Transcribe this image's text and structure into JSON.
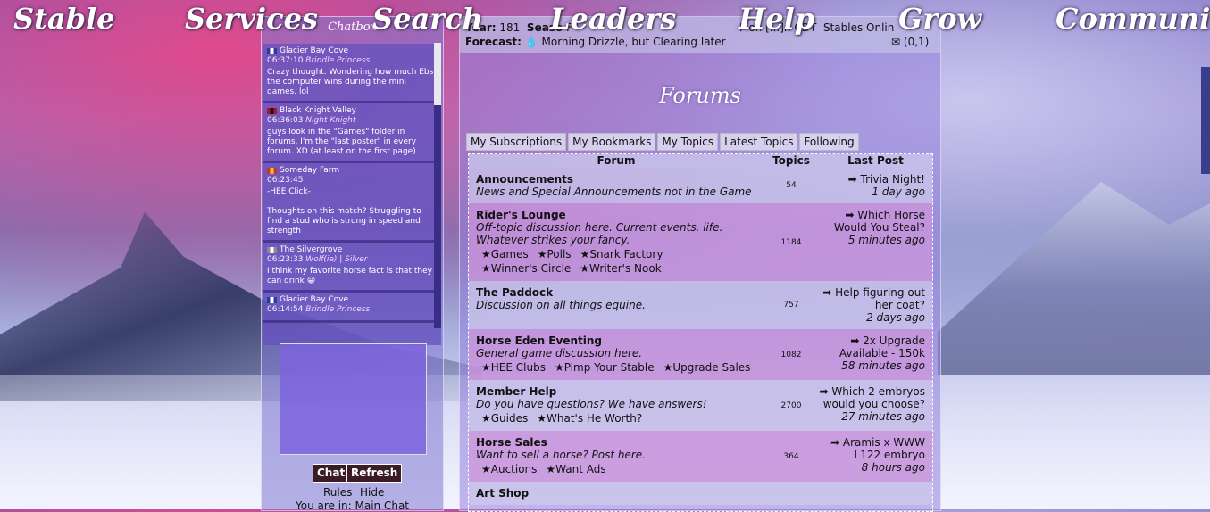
{
  "nav": [
    "Stable",
    "Services",
    "Search",
    "Leaders",
    "Help",
    "Grow",
    "Community"
  ],
  "chatbox": {
    "title": "Chatbox",
    "messages": [
      {
        "stable": "Glacier Bay Cove",
        "flag": [
          "#2b3d9a",
          "#ffffff",
          "#2b3d9a"
        ],
        "time": "06:37:10",
        "name": "Brindle Princess",
        "text": "Crazy thought. Wondering how much Ebs the computer wins during the mini games. lol"
      },
      {
        "stable": "Black Knight Valley",
        "flag": [
          "#b0142a",
          "#111111",
          "#b0142a"
        ],
        "time": "06:36:03",
        "name": "Night Knight",
        "text": "guys look in the \"Games\" folder in forums, I'm the \"last poster\" in every forum. XD (at least on the first page)"
      },
      {
        "stable": "Someday Farm",
        "flag": [
          "#c43a2a",
          "#f0c02a",
          "#c43a2a"
        ],
        "time": "06:23:45",
        "name": "",
        "text": "-HEE Click-\n\nThoughts on this match? Struggling to find a stud who is strong in speed and strength"
      },
      {
        "stable": "The Silvergrove",
        "flag": [
          "#8a8a8a",
          "#ffffff",
          "#8a8a8a"
        ],
        "time": "06:23:33",
        "name": "Wolf(ie) | Silver",
        "text": "I think my favorite horse fact is that they can drink 😀"
      },
      {
        "stable": "Glacier Bay Cove",
        "flag": [
          "#2b3d9a",
          "#ffffff",
          "#2b3d9a"
        ],
        "time": "06:14:54",
        "name": "Brindle Princess",
        "text": ""
      }
    ],
    "chat_button": "Chat",
    "refresh_button": "Refresh",
    "rules_link": "Rules",
    "hide_link": "Hide",
    "location": "You are in: Main Chat"
  },
  "info": {
    "year_label": "Year:",
    "year": "181",
    "season_label": "Seaso",
    "season": "F",
    "forecast_label": "Forecast:",
    "forecast": "Morning Drizzle, but Clearing later",
    "time": "Mon [...]n CDT",
    "stables_online": "Stables Onlin",
    "mail": "(0,1)"
  },
  "forum": {
    "heading": "Forums",
    "tabs": [
      "My Subscriptions",
      "My Bookmarks",
      "My Topics",
      "Latest Topics",
      "Following"
    ],
    "columns": [
      "Forum",
      "Topics",
      "Last Post"
    ],
    "rows": [
      {
        "title": "Announcements",
        "desc": "News and Special Announcements not in the Game",
        "subs": [],
        "topics": "54",
        "last": [
          "➡ Trivia Night!"
        ],
        "when": "1 day ago",
        "tone": "light"
      },
      {
        "title": "Rider's Lounge",
        "desc": "Off-topic discussion here. Current events. life. Whatever strikes your fancy.",
        "subs": [
          "★Games",
          "★Polls",
          "★Snark Factory",
          "★Winner's Circle",
          "★Writer's Nook"
        ],
        "topics": "1184",
        "last": [
          "➡ Which Horse",
          "Would You Steal?"
        ],
        "when": "5 minutes ago",
        "tone": "pink"
      },
      {
        "title": "The Paddock",
        "desc": "Discussion on all things equine.",
        "subs": [],
        "topics": "757",
        "last": [
          "➡ Help figuring out",
          "her coat?"
        ],
        "when": "2 days ago",
        "tone": "light"
      },
      {
        "title": "Horse Eden Eventing",
        "desc": "General game discussion here.",
        "subs": [
          "★HEE Clubs",
          "★Pimp Your Stable",
          "★Upgrade Sales"
        ],
        "topics": "1082",
        "last": [
          "➡ 2x Upgrade",
          "Available - 150k"
        ],
        "when": "58 minutes ago",
        "tone": "pink"
      },
      {
        "title": "Member Help",
        "desc": "Do you have questions? We have answers!",
        "subs": [
          "★Guides",
          "★What's He Worth?"
        ],
        "topics": "2700",
        "last": [
          "➡ Which 2 embryos",
          "would you choose?"
        ],
        "when": "27 minutes ago",
        "tone": "light"
      },
      {
        "title": "Horse Sales",
        "desc": "Want to sell a horse? Post here.",
        "subs": [
          "★Auctions",
          "★Want Ads"
        ],
        "topics": "364",
        "last": [
          "➡ Aramis x WWW",
          "L122 embryo"
        ],
        "when": "8 hours ago",
        "tone": "pink"
      },
      {
        "title": "Art Shop",
        "desc": "",
        "subs": [],
        "topics": "",
        "last": [],
        "when": "",
        "tone": "light"
      }
    ]
  }
}
